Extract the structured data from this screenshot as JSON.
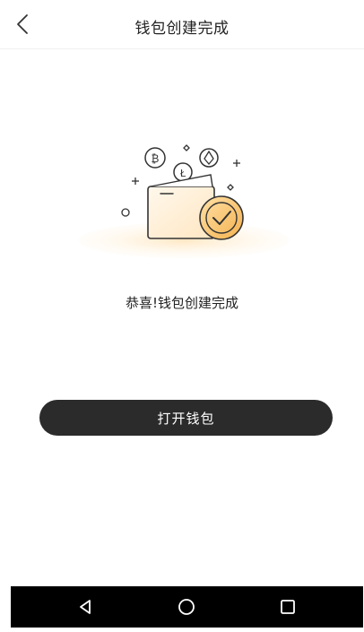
{
  "header": {
    "title": "钱包创建完成",
    "back_icon": "chevron-left-icon"
  },
  "illustration": {
    "description_icon": "wallet-with-coins-checkmark-icon",
    "accent_color": "#f6b14a",
    "coins": [
      "bitcoin",
      "litecoin",
      "ethereum"
    ]
  },
  "message": {
    "success_text": "恭喜!钱包创建完成"
  },
  "actions": {
    "open_wallet_label": "打开钱包"
  },
  "nav_bar": {
    "back_icon": "triangle-back-icon",
    "home_icon": "circle-home-icon",
    "recents_icon": "square-recents-icon"
  },
  "colors": {
    "button_bg": "#2b2b2b",
    "text_primary": "#222222",
    "nav_bg": "#000000"
  }
}
